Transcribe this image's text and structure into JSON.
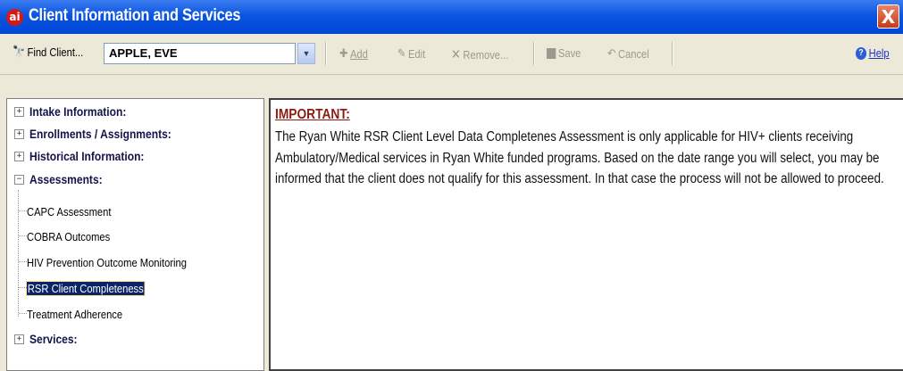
{
  "window": {
    "title": "Client Information and Services",
    "logo_text": "ai",
    "close_glyph": "X"
  },
  "toolbar": {
    "find_label": "Find Client...",
    "find_value": "APPLE, EVE",
    "add_label": "Add",
    "edit_label": "Edit",
    "remove_label": "Remove...",
    "save_label": "Save",
    "cancel_label": "Cancel",
    "help_label": "Help"
  },
  "tree": {
    "sections": [
      {
        "label": "Intake Information:",
        "expander": "+"
      },
      {
        "label": "Enrollments / Assignments:",
        "expander": "+"
      },
      {
        "label": "Historical Information:",
        "expander": "+"
      },
      {
        "label": "Assessments:",
        "expander": "−"
      }
    ],
    "assessments": [
      "CAPC Assessment",
      "COBRA Outcomes",
      "HIV Prevention Outcome Monitoring",
      "RSR Client Completeness",
      "Treatment Adherence"
    ],
    "services": {
      "label": "Services:",
      "expander": "+"
    }
  },
  "content": {
    "heading": "IMPORTANT:",
    "body": "The Ryan White RSR Client Level Data Completenes Assessment is only applicable for HIV+ clients receiving Ambulatory/Medical services in Ryan White funded programs.  Based on the date range you will select, you may be informed that the client does not qualify for this assessment.  In that case the process will not be allowed to proceed."
  },
  "colors": {
    "titlebar": "#0a55e0",
    "selected": "#0a246a",
    "important": "#8b1b0f"
  }
}
